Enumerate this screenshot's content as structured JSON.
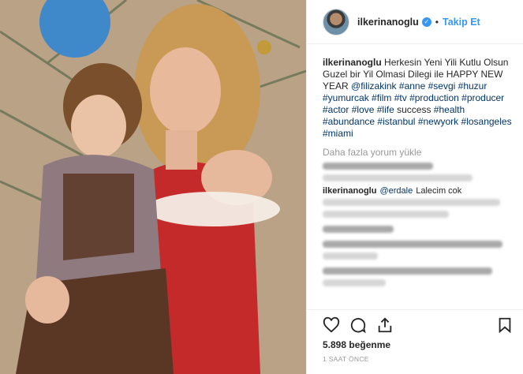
{
  "header": {
    "username": "ilkerinanoglu",
    "separator": "•",
    "follow_label": "Takip Et"
  },
  "caption": {
    "username": "ilkerinanoglu",
    "text": "Herkesin Yeni Yili Kutlu Olsun Guzel bir Yil Olmasi Dilegi ile HAPPY NEW YEAR",
    "mention": "@filizakink",
    "tags_1": [
      "#anne",
      "#sevgi",
      "#huzur",
      "#yumurcak",
      "#film",
      "#tv",
      "#production",
      "#producer",
      "#actor",
      "#love",
      "#life"
    ],
    "word_success": "success",
    "tags_2": [
      "#health",
      "#abundance",
      "#istanbul",
      "#newyork",
      "#losangeles",
      "#miami"
    ]
  },
  "load_more_label": "Daha fazla yorum yükle",
  "comment_fragment": {
    "username": "ilkerinanoglu",
    "mention": "@erdale",
    "text": "Lalecim cok"
  },
  "likes_text": "5.898 beğenme",
  "time_text": "1 SAAT ÖNCE",
  "icons": {
    "verified": "verified-badge-icon",
    "like": "heart-icon",
    "comment": "comment-bubble-icon",
    "share": "share-icon",
    "save": "bookmark-icon"
  },
  "colors": {
    "link_blue": "#3897f0",
    "hashtag": "#003569",
    "muted": "#999999",
    "border": "#efefef"
  }
}
